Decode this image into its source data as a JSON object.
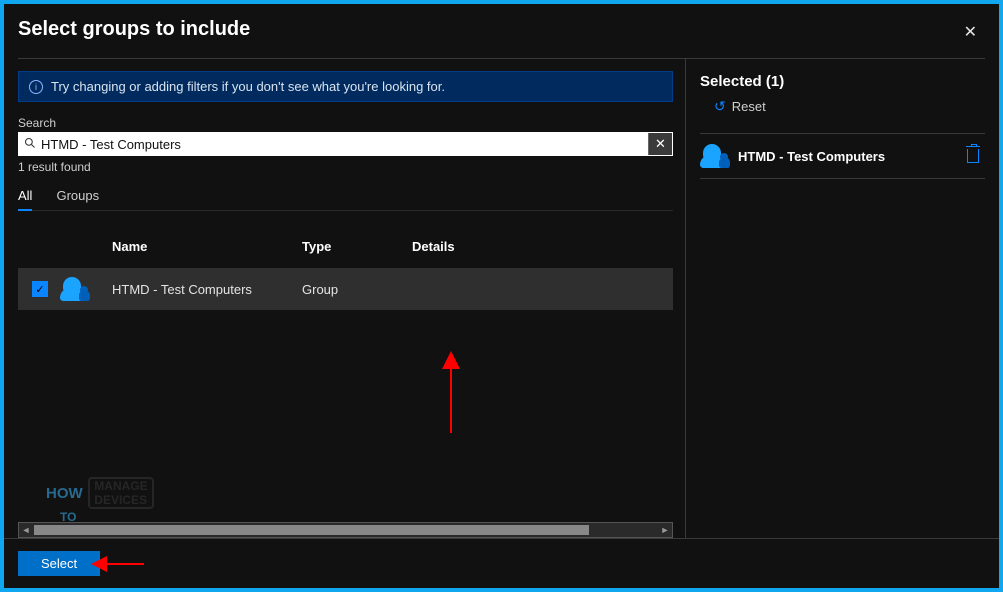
{
  "title": "Select groups to include",
  "info_message": "Try changing or adding filters if you don't see what you're looking for.",
  "search": {
    "label": "Search",
    "value": "HTMD - Test Computers",
    "result_text": "1 result found"
  },
  "tabs": {
    "all": "All",
    "groups": "Groups"
  },
  "columns": {
    "name": "Name",
    "type": "Type",
    "details": "Details"
  },
  "row": {
    "name": "HTMD - Test Computers",
    "type": "Group",
    "details": ""
  },
  "selected": {
    "title": "Selected (1)",
    "reset": "Reset",
    "items": [
      {
        "name": "HTMD - Test Computers"
      }
    ]
  },
  "footer": {
    "select": "Select"
  },
  "watermark": {
    "how": "HOW",
    "to": "TO",
    "line1": "MANAGE",
    "line2": "DEVICES"
  }
}
